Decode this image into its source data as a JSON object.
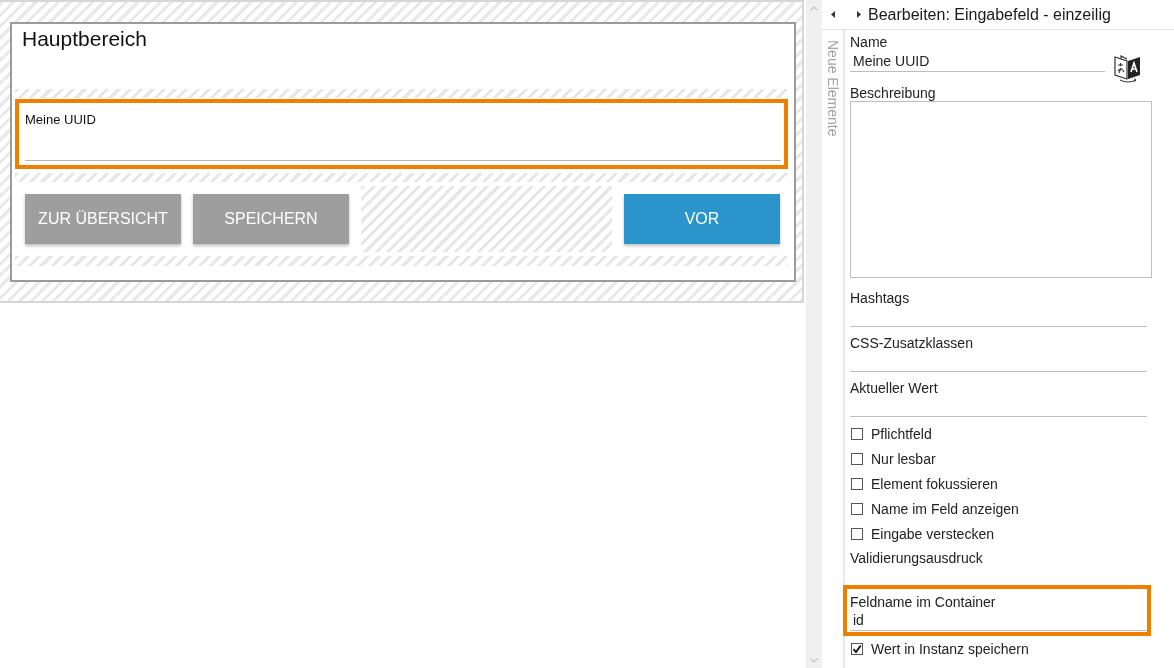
{
  "canvas": {
    "section": {
      "title": "Hauptbereich",
      "fields": [
        {
          "label": "Meine UUID",
          "selected": true
        }
      ],
      "actions": [
        {
          "kind": "secondary",
          "label": "ZUR ÜBERSICHT"
        },
        {
          "kind": "secondary",
          "label": "SPEICHERN"
        },
        {
          "kind": "empty_slot"
        },
        {
          "kind": "primary",
          "label": "VOR"
        }
      ]
    }
  },
  "sidebar_tab": {
    "label": "Neue Elemente"
  },
  "properties_panel": {
    "title": "Bearbeiten: Eingabefeld - einzeilig",
    "items": [
      {
        "kind": "text",
        "label": "Name",
        "value": "Meine UUID",
        "translatable": true,
        "highlighted": false
      },
      {
        "kind": "textarea",
        "label": "Beschreibung",
        "highlighted": false
      },
      {
        "kind": "text",
        "label": "Hashtags",
        "highlighted": false
      },
      {
        "kind": "text",
        "label": "CSS-Zusatzklassen",
        "highlighted": false
      },
      {
        "kind": "text",
        "label": "Aktueller Wert",
        "highlighted": false
      },
      {
        "kind": "checkbox",
        "label": "Pflichtfeld",
        "checked": false,
        "highlighted": false
      },
      {
        "kind": "checkbox",
        "label": "Nur lesbar",
        "checked": false,
        "highlighted": false
      },
      {
        "kind": "checkbox",
        "label": "Element fokussieren",
        "checked": false,
        "highlighted": false
      },
      {
        "kind": "checkbox",
        "label": "Name im Feld anzeigen",
        "checked": false,
        "highlighted": false
      },
      {
        "kind": "checkbox",
        "label": "Eingabe verstecken",
        "checked": false,
        "highlighted": false
      },
      {
        "kind": "caption",
        "label": "Validierungsausdruck",
        "highlighted": false
      },
      {
        "kind": "text",
        "label": "Feldname im Container",
        "value": "id",
        "highlighted": true
      },
      {
        "kind": "checkbox",
        "label": "Wert in Instanz speichern",
        "checked": true,
        "highlighted": false
      }
    ]
  }
}
